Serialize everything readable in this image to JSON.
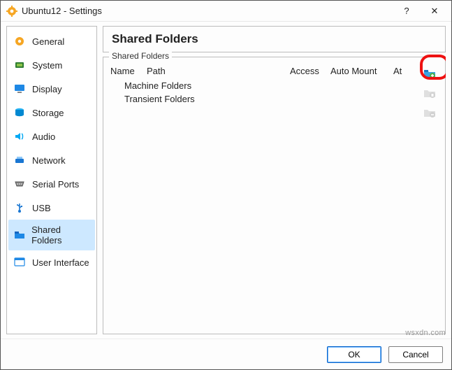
{
  "window": {
    "title": "Ubuntu12 - Settings",
    "help_glyph": "?",
    "close_glyph": "✕"
  },
  "sidebar": {
    "items": [
      {
        "label": "General"
      },
      {
        "label": "System"
      },
      {
        "label": "Display"
      },
      {
        "label": "Storage"
      },
      {
        "label": "Audio"
      },
      {
        "label": "Network"
      },
      {
        "label": "Serial Ports"
      },
      {
        "label": "USB"
      },
      {
        "label": "Shared Folders"
      },
      {
        "label": "User Interface"
      }
    ]
  },
  "main": {
    "title": "Shared Folders",
    "group_label": "Shared Folders",
    "columns": {
      "name": "Name",
      "path": "Path",
      "access": "Access",
      "automount": "Auto Mount",
      "at": "At"
    },
    "rows": [
      {
        "label": "Machine Folders"
      },
      {
        "label": "Transient Folders"
      }
    ]
  },
  "buttons": {
    "ok": "OK",
    "cancel": "Cancel"
  },
  "watermark": "wsxdn.com"
}
